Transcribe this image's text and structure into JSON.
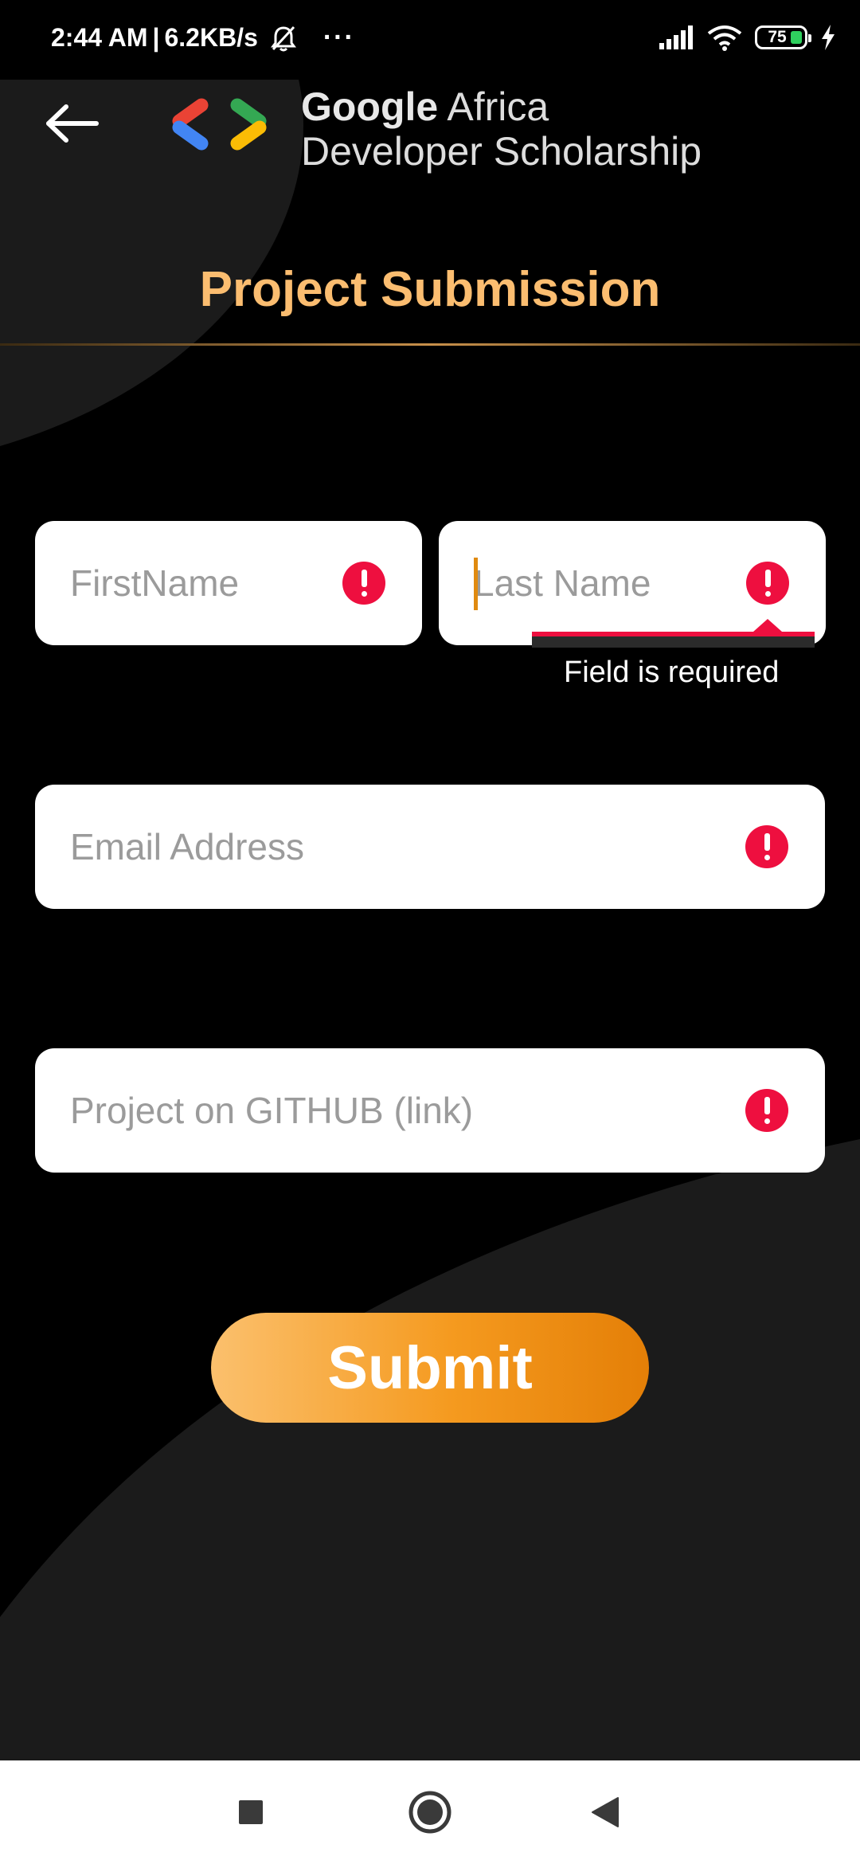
{
  "status_bar": {
    "time": "2:44 AM",
    "separator": "|",
    "network_speed": "6.2KB/s",
    "more_indicator": "···",
    "battery_level": "75",
    "icons": [
      "dnd-off-icon",
      "signal-icon",
      "wifi-icon",
      "battery-icon",
      "charging-icon"
    ]
  },
  "header": {
    "back_icon": "arrow-left-icon",
    "brand_line1_bold": "Google",
    "brand_line1_rest": " Africa",
    "brand_line2": "Developer Scholarship"
  },
  "page": {
    "title": "Project Submission"
  },
  "form": {
    "first_name_placeholder": "FirstName",
    "last_name_placeholder": "Last Name",
    "email_placeholder": "Email Address",
    "github_placeholder": "Project on GITHUB (link)",
    "error_message": "Field is required",
    "submit_label": "Submit"
  },
  "nav_bar": {
    "items": [
      "recents-square-icon",
      "home-circle-icon",
      "back-triangle-icon"
    ]
  },
  "colors": {
    "accent": "#fbbd70",
    "error": "#ee0f3f",
    "button_start": "#fbc06d",
    "button_end": "#e47f07",
    "background": "#000000"
  }
}
